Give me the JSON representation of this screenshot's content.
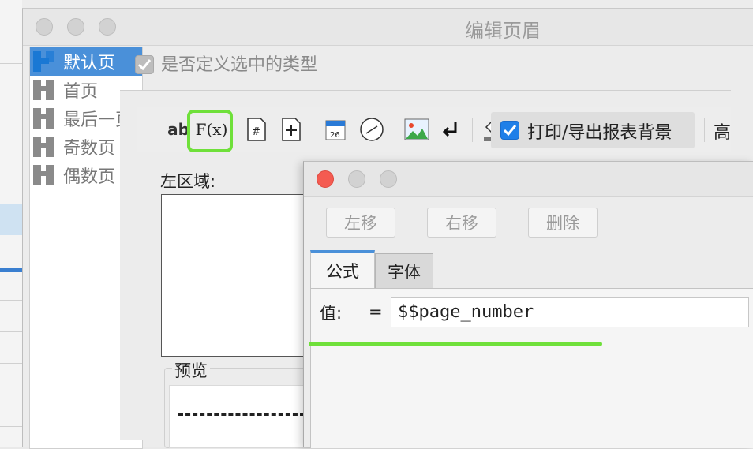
{
  "main_dialog": {
    "title": "编辑页眉"
  },
  "page_list": {
    "items": [
      {
        "label": "默认页",
        "selected": true
      },
      {
        "label": "首页",
        "selected": false
      },
      {
        "label": "最后一页",
        "selected": false
      },
      {
        "label": "奇数页",
        "selected": false
      },
      {
        "label": "偶数页",
        "selected": false
      }
    ]
  },
  "define_type": {
    "label": "是否定义选中的类型",
    "checked": true
  },
  "toolbar": {
    "text_tool_label": "ab",
    "formula_tool_label": "F(x)",
    "date_icon_text": "26",
    "print_background": {
      "label": "打印/导出报表背景",
      "checked": true
    },
    "high_label": "高"
  },
  "left_region": {
    "label": "左区域:"
  },
  "preview": {
    "label": "预览"
  },
  "formula_dialog": {
    "buttons": {
      "move_left": "左移",
      "move_right": "右移",
      "delete": "删除"
    },
    "tabs": [
      {
        "label": "公式",
        "active": true
      },
      {
        "label": "字体",
        "active": false
      }
    ],
    "value_label": "值:",
    "equals": "=",
    "formula_value": "$$page_number"
  },
  "colors": {
    "accent": "#4a90d9",
    "highlight": "#6fe03a",
    "close_red": "#f45b51",
    "checkbox_blue": "#1f7fe8"
  },
  "icons": {
    "page_item": "page-layout-icon",
    "fx": "formula-icon",
    "page_number": "page-number-icon",
    "total_pages": "total-pages-icon",
    "date": "calendar-icon",
    "time": "clock-icon",
    "image": "image-icon",
    "newline": "newline-icon",
    "background": "paint-bucket-icon"
  }
}
